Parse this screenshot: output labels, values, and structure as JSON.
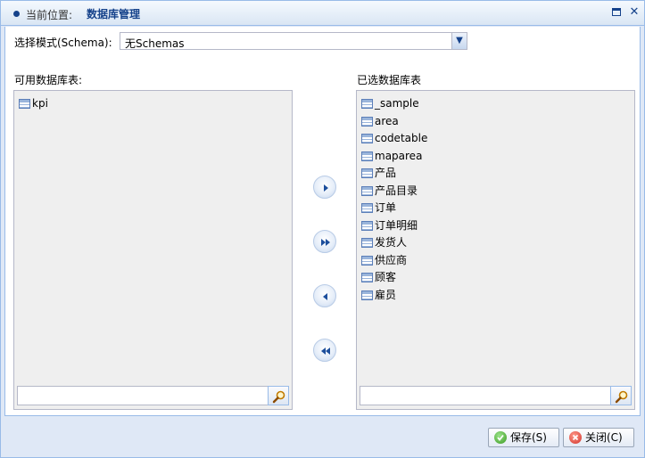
{
  "window": {
    "title_prefix": "当前位置:",
    "title": "数据库管理"
  },
  "schema": {
    "label": "选择模式(Schema):",
    "selected": "无Schemas"
  },
  "available": {
    "label": "可用数据库表:",
    "items": [
      "kpi"
    ],
    "search_value": ""
  },
  "selected_tables": {
    "label": "已选数据库表",
    "items": [
      "_sample",
      "area",
      "codetable",
      "maparea",
      "产品",
      "产品目录",
      "订单",
      "订单明细",
      "发货人",
      "供应商",
      "顾客",
      "雇员"
    ],
    "search_value": ""
  },
  "actions": {
    "save": "保存(S)",
    "close": "关闭(C)"
  },
  "icons": {
    "table": "table-icon",
    "search": "search-icon",
    "move_right": "arrow-right-icon",
    "move_all_right": "double-arrow-right-icon",
    "move_left": "arrow-left-icon",
    "move_all_left": "double-arrow-left-icon",
    "save": "check-circle-icon",
    "close": "x-circle-icon"
  },
  "colors": {
    "title_text": "#15428b",
    "border": "#99bbe8",
    "list_bg": "#efefef"
  }
}
